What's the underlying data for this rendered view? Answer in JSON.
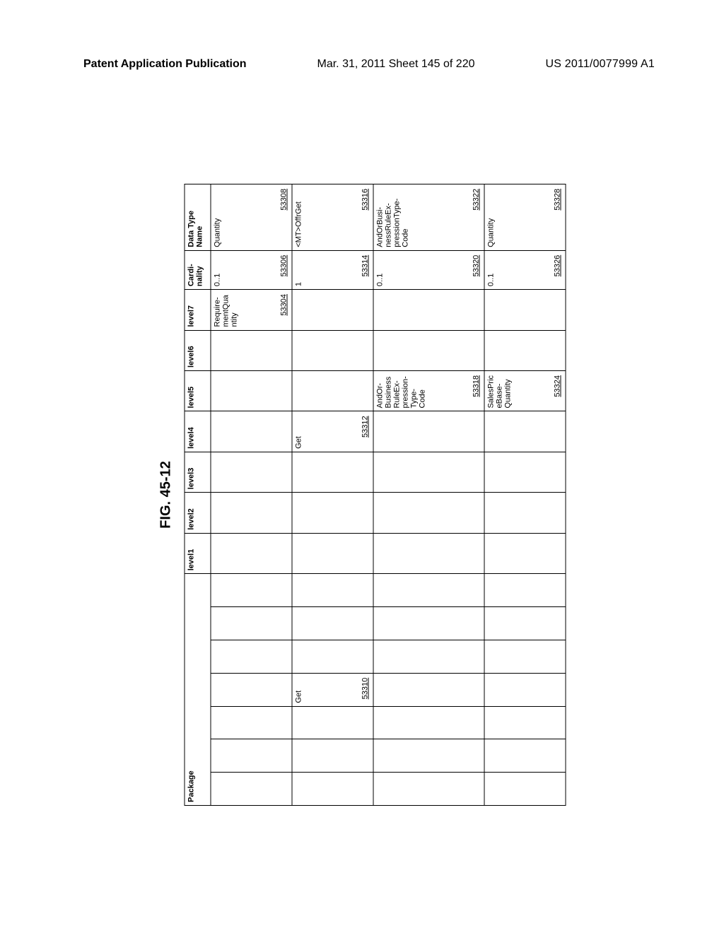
{
  "header": {
    "left": "Patent Application Publication",
    "mid": "Mar. 31, 2011  Sheet 145 of 220",
    "right": "US 2011/0077999 A1"
  },
  "figure_label": "FIG. 45-12",
  "columns": {
    "package": "Package",
    "l1": "level1",
    "l2": "level2",
    "l3": "level3",
    "l4": "level4",
    "l5": "level5",
    "l6": "level6",
    "l7": "level7",
    "card": "Cardi-nality",
    "dtn": "Data Type Name"
  },
  "rows": [
    {
      "package": "",
      "l4": "",
      "l5": "",
      "l7": {
        "text": "Require-mentQuantity",
        "ref": "53304"
      },
      "card": {
        "text": "0..1",
        "ref": "53306"
      },
      "dtn": {
        "text": "Quantity",
        "ref": "53308"
      }
    },
    {
      "package": {
        "text": "Get",
        "ref": "53310"
      },
      "l4": {
        "text": "Get",
        "ref": "53312"
      },
      "l5": "",
      "l7": "",
      "card": {
        "text": "1",
        "ref": "53314"
      },
      "dtn": {
        "text": "<MT>OffrGet",
        "ref": "53316"
      }
    },
    {
      "package": "",
      "l4": "",
      "l5": {
        "text": "AndOr-BusinessRuleEx-pression-Type-Code",
        "ref": "53318"
      },
      "l7": "",
      "card": {
        "text": "0..1",
        "ref": "53320"
      },
      "dtn": {
        "text": "AndOrBusi-nessRuleEx-pressionType-Code",
        "ref": "53322"
      }
    },
    {
      "package": "",
      "l4": "",
      "l5": {
        "text": "SalesPriceBase-Quantity",
        "ref": "53324"
      },
      "l7": "",
      "card": {
        "text": "0..1",
        "ref": "53326"
      },
      "dtn": {
        "text": "Quantity",
        "ref": "53328"
      }
    }
  ]
}
